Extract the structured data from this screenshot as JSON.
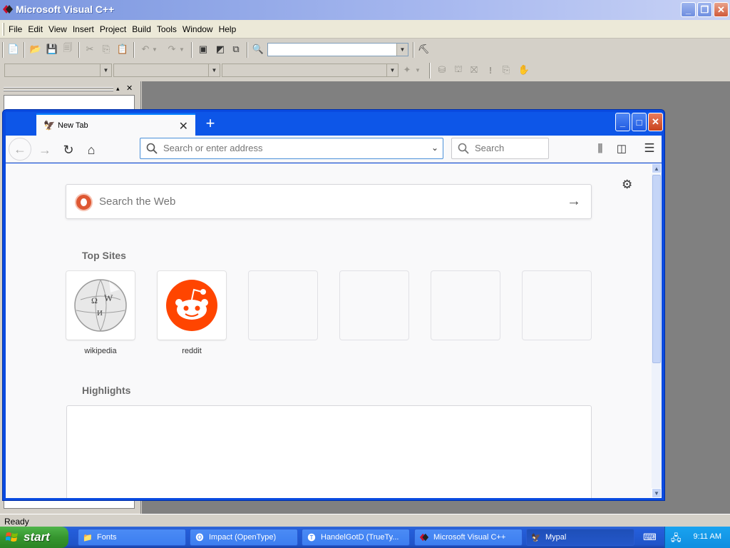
{
  "vc_window": {
    "title": "Microsoft Visual C++",
    "menus": [
      "File",
      "Edit",
      "View",
      "Insert",
      "Project",
      "Build",
      "Tools",
      "Window",
      "Help"
    ],
    "status_text": "Ready"
  },
  "browser": {
    "tab_title": "New Tab",
    "url_placeholder": "Search or enter address",
    "search_placeholder": "Search",
    "web_search_placeholder": "Search the Web",
    "top_sites_title": "Top Sites",
    "highlights_title": "Highlights",
    "top_sites": [
      {
        "label": "wikipedia",
        "icon": "wikipedia-globe-icon"
      },
      {
        "label": "reddit",
        "icon": "reddit-alien-icon"
      },
      {
        "label": "",
        "icon": ""
      },
      {
        "label": "",
        "icon": ""
      },
      {
        "label": "",
        "icon": ""
      },
      {
        "label": "",
        "icon": ""
      }
    ],
    "colors": {
      "reddit": "#ff4500",
      "accent": "#0a84ff",
      "duckduckgo": "#de5833"
    }
  },
  "taskbar": {
    "start_label": "start",
    "tasks": [
      {
        "label": "Fonts",
        "icon": "folder-icon"
      },
      {
        "label": "Impact (OpenType)",
        "icon": "font-file-icon"
      },
      {
        "label": "HandelGotD (TrueTy...",
        "icon": "font-file-icon"
      },
      {
        "label": "Microsoft Visual C++",
        "icon": "visual-cpp-icon"
      },
      {
        "label": "Mypal",
        "icon": "mypal-icon"
      }
    ],
    "clock": "9:11 AM"
  }
}
